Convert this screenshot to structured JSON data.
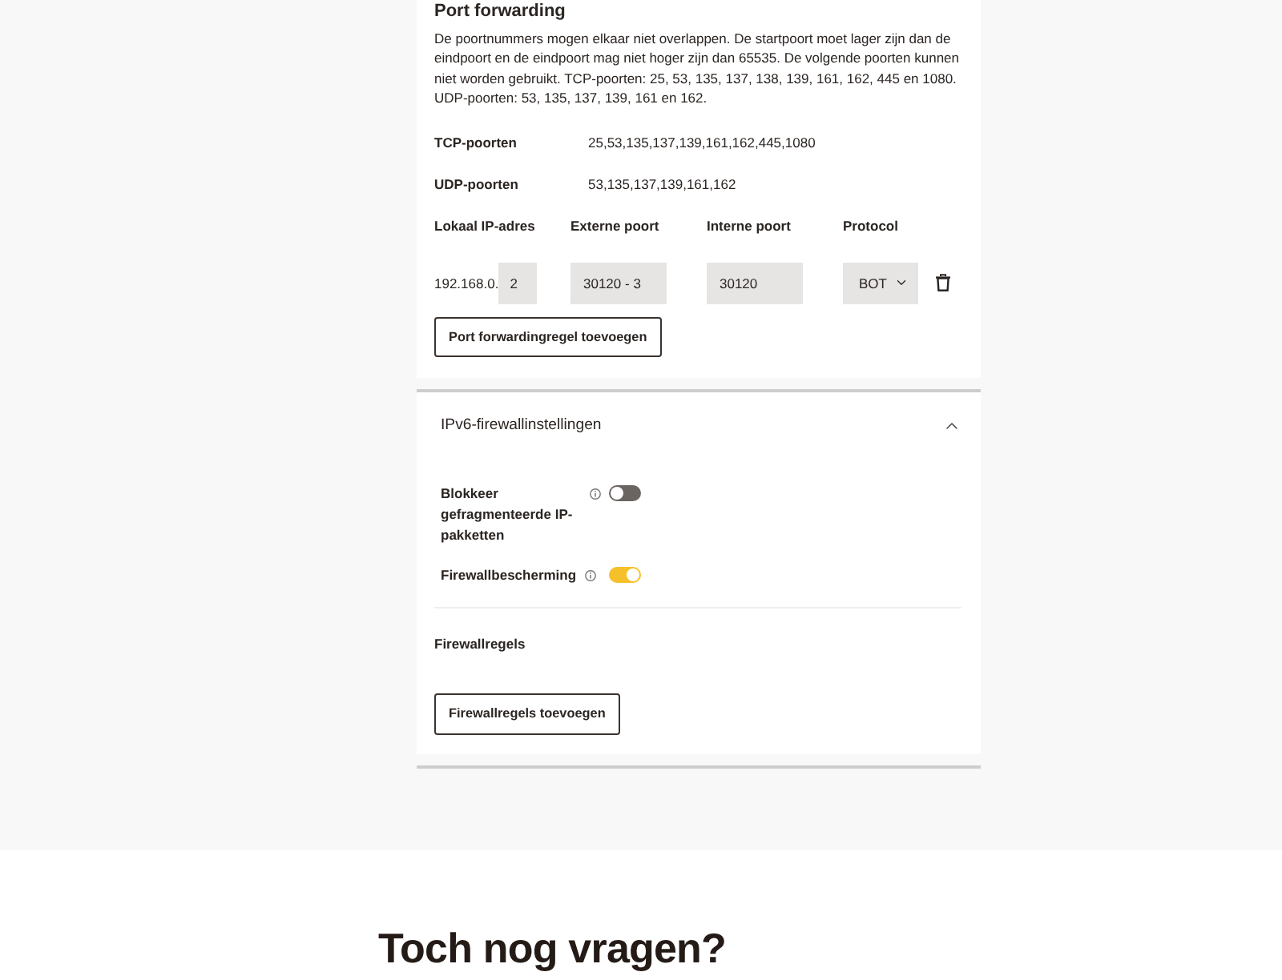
{
  "port_forwarding": {
    "title": "Port forwarding",
    "description": "De poortnummers mogen elkaar niet overlappen. De startpoort moet lager zijn dan de eindpoort en de eindpoort mag niet hoger zijn dan 65535. De volgende poorten kunnen niet worden gebruikt. TCP-poorten: 25, 53, 135, 137, 138, 139, 161, 162, 445 en 1080. UDP-poorten: 53, 135, 137, 139, 161 en 162.",
    "reserved_ports": [
      {
        "label": "TCP-poorten",
        "value": "25,53,135,137,139,161,162,445,1080"
      },
      {
        "label": "UDP-poorten",
        "value": "53,135,137,139,161,162"
      }
    ],
    "rule_columns": [
      "Lokaal IP-adres",
      "Externe poort",
      "Interne poort",
      "Protocol"
    ],
    "rules": [
      {
        "ip_prefix": "192.168.0.",
        "ip_suffix": "2",
        "external_port": "30120 - 3",
        "internal_port": "30120",
        "protocol": "BOT"
      }
    ],
    "add_button": "Port forwardingregel toevoegen"
  },
  "ipv6_firewall": {
    "title": "IPv6-firewallinstellingen",
    "expanded": true,
    "settings": [
      {
        "label": "Blokkeer gefragmenteerde IP-pakketten",
        "on": false
      },
      {
        "label": "Firewallbescherming",
        "on": true
      }
    ],
    "rules_title": "Firewallregels",
    "add_button": "Firewallregels toevoegen"
  },
  "faq": {
    "title": "Toch nog vragen?"
  }
}
